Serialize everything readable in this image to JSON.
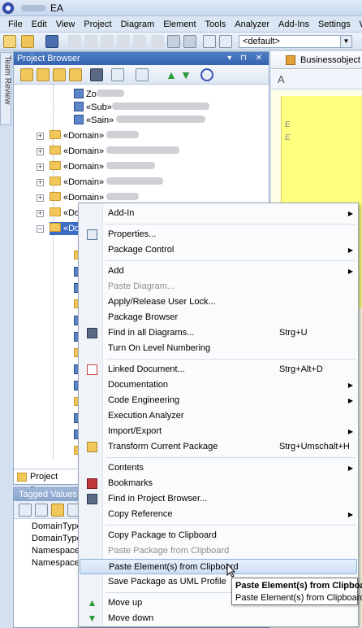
{
  "window": {
    "title": "EA"
  },
  "menu": [
    "File",
    "Edit",
    "View",
    "Project",
    "Diagram",
    "Element",
    "Tools",
    "Analyzer",
    "Add-Ins",
    "Settings",
    "W"
  ],
  "toolbar": {
    "combo_value": "<default>"
  },
  "side_tab": {
    "label": "Team Review"
  },
  "project_browser": {
    "title": "Project Browser",
    "controls": "▾ ⊓ ✕",
    "tab_label": "Project Browse",
    "tree": [
      {
        "label": "Zo",
        "kind": "pkg"
      },
      {
        "label": "«Sub»",
        "kind": "pkg"
      },
      {
        "label": "«Sain» ",
        "kind": "pkg"
      },
      {
        "label": "«Domain» ",
        "kind": "folder"
      },
      {
        "label": "«Domain» ",
        "kind": "folder"
      },
      {
        "label": "«Domain» ",
        "kind": "folder"
      },
      {
        "label": "«Domain» ",
        "kind": "folder"
      },
      {
        "label": "«Domain» ",
        "kind": "folder"
      },
      {
        "label": "«Domain» ",
        "kind": "folder"
      },
      {
        "label": "«Domain» ",
        "kind": "folder",
        "selected": true
      }
    ]
  },
  "tagged_values": {
    "title": "Tagged Values",
    "rows": [
      "DomainType",
      "DomainType",
      "Namespace",
      "NamespacePref"
    ]
  },
  "document_tab": {
    "label": "Businessobject D"
  },
  "diagram_notes": [
    "E",
    "E"
  ],
  "context_menu": {
    "items": [
      {
        "label": "Add-In",
        "submenu": true
      },
      {
        "sep": true
      },
      {
        "label": "Properties...",
        "icon": "properties-icon"
      },
      {
        "label": "Package Control",
        "submenu": true
      },
      {
        "sep": true
      },
      {
        "label": "Add",
        "submenu": true
      },
      {
        "label": "Paste Diagram...",
        "disabled": true
      },
      {
        "label": "Apply/Release User Lock..."
      },
      {
        "label": "Package Browser"
      },
      {
        "label": "Find in all Diagrams...",
        "shortcut": "Strg+U",
        "icon": "find-diagrams-icon"
      },
      {
        "label": "Turn On Level Numbering"
      },
      {
        "sep": true
      },
      {
        "label": "Linked Document...",
        "shortcut": "Strg+Alt+D",
        "icon": "linked-document-icon"
      },
      {
        "label": "Documentation",
        "submenu": true
      },
      {
        "label": "Code Engineering",
        "submenu": true
      },
      {
        "label": "Execution Analyzer"
      },
      {
        "label": "Import/Export",
        "submenu": true
      },
      {
        "label": "Transform Current Package",
        "shortcut": "Strg+Umschalt+H",
        "icon": "transform-icon"
      },
      {
        "sep": true
      },
      {
        "label": "Contents",
        "submenu": true
      },
      {
        "label": "Bookmarks",
        "icon": "bookmarks-icon"
      },
      {
        "label": "Find in Project Browser...",
        "icon": "find-browser-icon"
      },
      {
        "label": "Copy Reference",
        "submenu": true
      },
      {
        "sep": true
      },
      {
        "label": "Copy Package to Clipboard"
      },
      {
        "label": "Paste Package from Clipboard",
        "disabled": true
      },
      {
        "label": "Paste Element(s) from Clipboard",
        "highlighted": true
      },
      {
        "label": "Save Package as UML Profile"
      },
      {
        "sep": true
      },
      {
        "label": "Move up",
        "icon": "move-up-icon"
      },
      {
        "label": "Move down",
        "icon": "move-down-icon"
      }
    ]
  },
  "tooltip": {
    "title": "Paste Element(s) from Clipboard",
    "text": "Paste Element(s) from Clipboard"
  },
  "colors": {
    "selection": "#3b6cc6",
    "menu_highlight": "#cfdff4",
    "folder": "#f1c75a",
    "title_blue": "#3563b0"
  }
}
